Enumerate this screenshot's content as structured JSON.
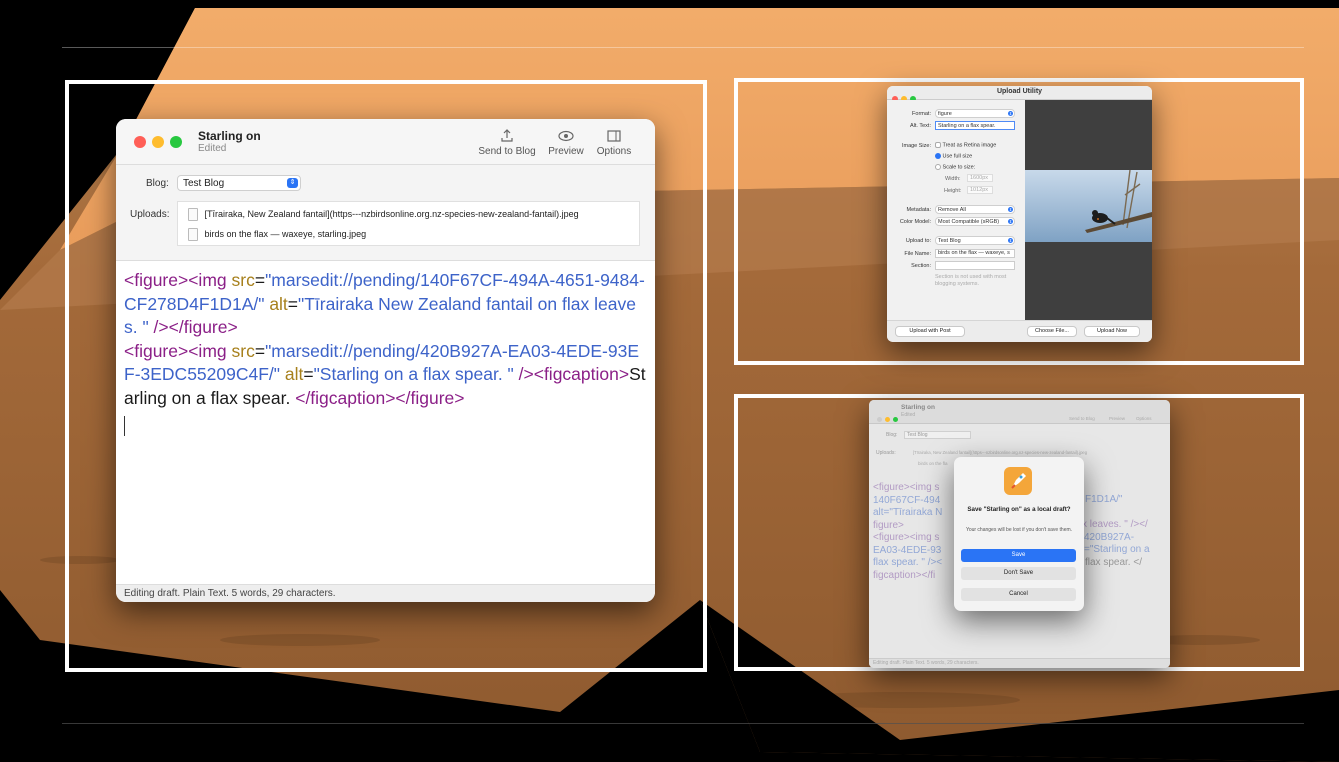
{
  "left_window": {
    "title": "Starling on",
    "subtitle": "Edited",
    "toolbar": {
      "send_label": "Send to Blog",
      "preview_label": "Preview",
      "options_label": "Options"
    },
    "blog_label": "Blog:",
    "blog_value": "Test Blog",
    "uploads_label": "Uploads:",
    "uploads": [
      "[Tīrairaka, New Zealand fantail](https---nzbirdsonline.org.nz-species-new-zealand-fantail).jpeg",
      "birds on the flax — waxeye, starling.jpeg"
    ],
    "code": {
      "l1_tag_open": "<figure><img ",
      "l1_src_attr": "src",
      "l1_eq": "=",
      "l1_src_val": "\"marsedit://pending/140F67CF-494A-4651-9484-CF278D4F1D1A/\"",
      "l1_alt_attr": "alt",
      "l1_alt_val": "\"Tīrairaka New Zealand fantail on flax leaves. \"",
      "l1_close": " /></figure>",
      "l2_tag_open": "<figure><img ",
      "l2_src_attr": "src",
      "l2_src_val": "\"marsedit://pending/420B927A-EA03-4EDE-93EF-3EDC55209C4F/\"",
      "l2_alt_attr": "alt",
      "l2_alt_val": "\"Starling on a flax spear. \"",
      "l2_mid": " /><figcaption>",
      "l2_caption": "Starling on a flax spear.  ",
      "l2_close": "</figcaption></figure>"
    },
    "status": "Editing draft. Plain Text. 5 words, 29 characters."
  },
  "upload_window": {
    "title": "Upload Utility",
    "format_label": "Format:",
    "format_value": "figure",
    "alt_label": "Alt. Text:",
    "alt_value": "Starling on a flax spear.",
    "size_label": "Image Size:",
    "retina_label": "Treat as Retina image",
    "full_size_label": "Use full size",
    "scale_label": "Scale to size:",
    "width_label": "Width:",
    "width_value": "1600px",
    "height_label": "Height:",
    "height_value": "1012px",
    "metadata_label": "Metadata:",
    "metadata_value": "Remove All",
    "color_label": "Color Model:",
    "color_value": "Most Compatible (sRGB)",
    "upload_to_label": "Upload to:",
    "upload_to_value": "Test Blog",
    "filename_label": "File Name:",
    "filename_value": "birds on the flax — waxeye, s",
    "section_label": "Section:",
    "section_note": "Section is not used with most blogging systems.",
    "upload_with_post": "Upload with Post",
    "choose_file": "Choose File...",
    "upload_now": "Upload Now"
  },
  "save_sheet": {
    "title": "Save \"Starling on\" as a local draft?",
    "body": "Your changes will be lost if you don't save them.",
    "save": "Save",
    "dont_save": "Don't Save",
    "cancel": "Cancel"
  },
  "bg_window": {
    "title": "Starling on",
    "subtitle": "Edited",
    "send": "Send to Blog",
    "preview": "Preview",
    "options": "Options",
    "blog_label": "Blog:",
    "blog_value": "Test Blog",
    "uploads_label": "Uploads:",
    "upload1": "[Tīrairaka, New Zealand fantail](https---nzbirdsonline.org.nz-species-new-zealand-fantail).jpeg",
    "upload2": "birds on the fla",
    "l1": "<figure><img s",
    "l1r": "F1D1A/\"",
    "l2": "140F67CF-494",
    "l3": "alt=\"Tīrairaka N",
    "l3r": "x leaves. \" /></",
    "l4": "figure>",
    "l5": "<figure><img s",
    "l5r": "420B927A-",
    "l6": "EA03-4EDE-93",
    "l6r": "=\"Starling on a",
    "l7": "flax spear. \" /><",
    "l7r": "flax spear.  </",
    "l8": "figcaption></fi",
    "status": "Editing draft. Plain Text. 5 words, 29 characters."
  },
  "colors": {
    "accent": "#2a74f5",
    "tag": "#8b1f87",
    "attr": "#a7801c",
    "value": "#3d63c9",
    "sky": "#f0a866"
  }
}
